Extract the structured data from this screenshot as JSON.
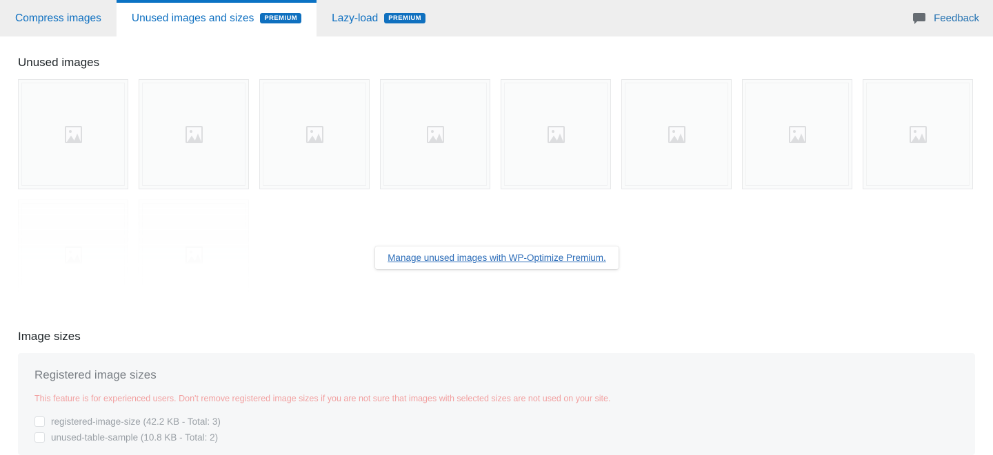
{
  "tabs": [
    {
      "label": "Compress images",
      "premium": false,
      "active": false,
      "name": "tab-compress-images"
    },
    {
      "label": "Unused images and sizes",
      "premium": true,
      "active": true,
      "name": "tab-unused-images-and-sizes"
    },
    {
      "label": "Lazy-load",
      "premium": true,
      "active": false,
      "name": "tab-lazy-load"
    }
  ],
  "badge_text": "PREMIUM",
  "feedback": {
    "label": "Feedback",
    "icon": "speech-bubble-icon"
  },
  "unused_images": {
    "title": "Unused images",
    "tile_icon": "image-placeholder-icon",
    "row1_count": 8,
    "row2_count": 2
  },
  "popup": {
    "link_text": "Manage unused images with WP-Optimize Premium."
  },
  "image_sizes": {
    "title": "Image sizes",
    "panel_title": "Registered image sizes",
    "warning": "This feature is for experienced users. Don't remove registered image sizes if you are not sure that images with selected sizes are not used on your site.",
    "rows": [
      {
        "label": "registered-image-size (42.2 KB - Total: 3)",
        "checked": false
      },
      {
        "label": "unused-table-sample (10.8 KB - Total: 2)",
        "checked": false
      }
    ]
  },
  "colors": {
    "accent_blue": "#0b72c4",
    "link_blue": "#2271b1",
    "warning_red": "#f2a0a0",
    "panel_bg": "#f6f7f8",
    "tabbar_bg": "#eeeeee"
  }
}
